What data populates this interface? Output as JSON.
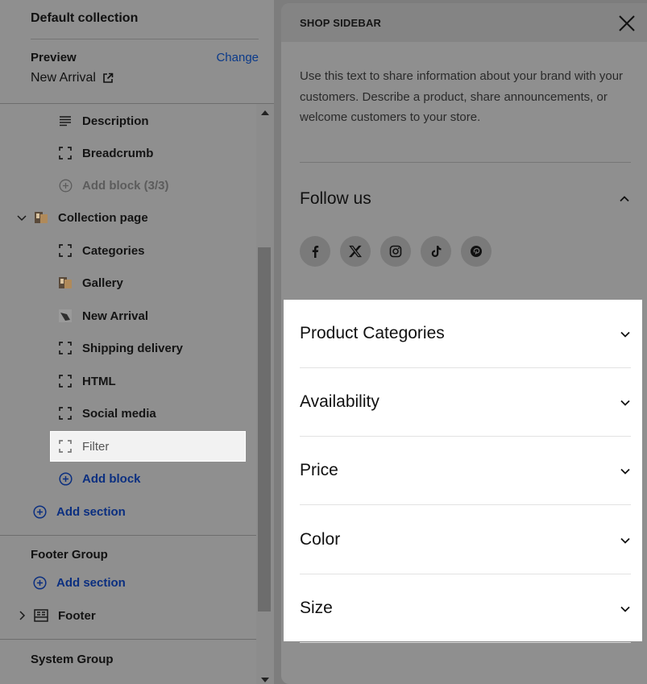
{
  "left_panel": {
    "collection_title": "Default collection",
    "preview_label": "Preview",
    "change_label": "Change",
    "preview_value": "New Arrival",
    "tree": {
      "description": "Description",
      "breadcrumb": "Breadcrumb",
      "add_block_limited": "Add block (3/3)",
      "collection_page": "Collection page",
      "blocks": [
        "Categories",
        "Gallery",
        "New Arrival",
        "Shipping delivery",
        "HTML",
        "Social media",
        "Filter"
      ],
      "add_block": "Add block",
      "add_section": "Add section"
    },
    "footer_group": {
      "title": "Footer Group",
      "add_section": "Add section",
      "footer": "Footer"
    },
    "system_group": {
      "title": "System Group"
    }
  },
  "right_panel": {
    "title": "SHOP SIDEBAR",
    "description": "Use this text to share information about your brand with your customers. Describe a product, share announcements, or welcome customers to your store.",
    "follow_us": "Follow us",
    "socials": [
      "facebook-icon",
      "x-icon",
      "instagram-icon",
      "tiktok-icon",
      "pinterest-icon"
    ],
    "filters": [
      "Product Categories",
      "Availability",
      "Price",
      "Color",
      "Size"
    ]
  },
  "colors": {
    "link_blue": "#0b3a8a",
    "selected_bg": "#f2f2f2",
    "filter_bg": "#ffffff",
    "overlay_gray": "#8f8f8f"
  }
}
